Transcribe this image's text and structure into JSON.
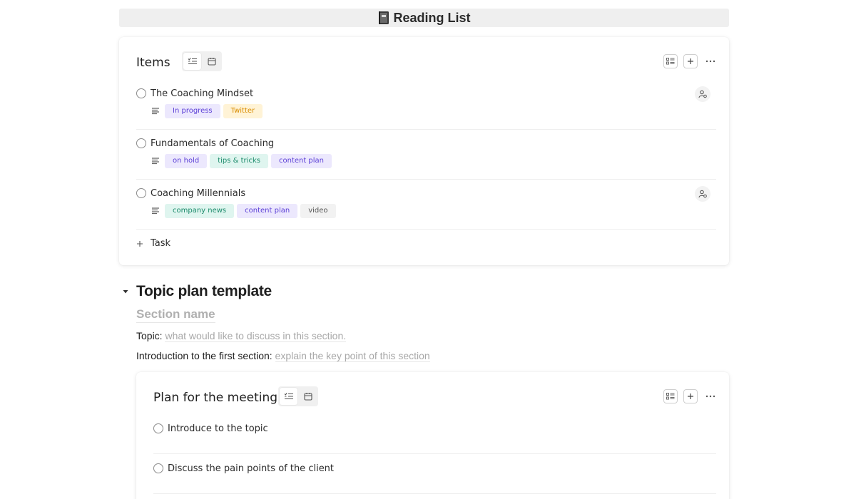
{
  "page": {
    "title": "Reading List"
  },
  "items_board": {
    "title": "Items",
    "tasks": [
      {
        "name": "The Coaching Mindset",
        "tags": [
          {
            "label": "In progress",
            "bg": "#ece8fd",
            "fg": "#5b3fd6"
          },
          {
            "label": "Twitter",
            "bg": "#fff3d6",
            "fg": "#d98c00"
          }
        ],
        "assigned": true
      },
      {
        "name": "Fundamentals of Coaching",
        "tags": [
          {
            "label": "on hold",
            "bg": "#ece8fd",
            "fg": "#5b3fd6"
          },
          {
            "label": "tips & tricks",
            "bg": "#dff5ef",
            "fg": "#1a8a6a"
          },
          {
            "label": "content plan",
            "bg": "#ece8fd",
            "fg": "#5b3fd6"
          }
        ],
        "assigned": false
      },
      {
        "name": "Coaching Millennials",
        "tags": [
          {
            "label": "company news",
            "bg": "#dff5ef",
            "fg": "#1a8a6a"
          },
          {
            "label": "content plan",
            "bg": "#ece8fd",
            "fg": "#5b3fd6"
          },
          {
            "label": "video",
            "bg": "#f2f2f2",
            "fg": "#555555"
          }
        ],
        "assigned": true
      }
    ],
    "add_label": "Task"
  },
  "topic_section": {
    "title": "Topic plan template",
    "section_name": "Section name",
    "topic_label": "Topic:",
    "topic_placeholder": "what would like to discuss in this section.",
    "intro_label": "Introduction to the first section:",
    "intro_placeholder": "explain the key point of this section"
  },
  "meeting_board": {
    "title": "Plan for the meeting",
    "tasks": [
      {
        "name": "Introduce to the topic"
      },
      {
        "name": "Discuss the pain points of the client"
      }
    ]
  }
}
